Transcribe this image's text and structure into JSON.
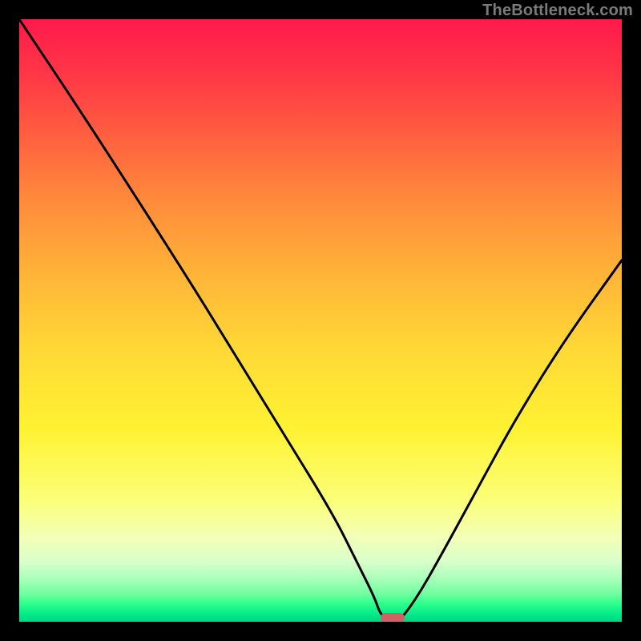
{
  "watermark": "TheBottleneck.com",
  "chart_data": {
    "type": "line",
    "title": "",
    "xlabel": "",
    "ylabel": "",
    "xlim": [
      0,
      100
    ],
    "ylim": [
      0,
      100
    ],
    "grid": false,
    "series": [
      {
        "name": "bottleneck-curve",
        "x": [
          0,
          12,
          28,
          36,
          44,
          52,
          56,
          59,
          60,
          62,
          63,
          66,
          70,
          76,
          82,
          90,
          100
        ],
        "values": [
          100,
          82,
          57,
          44,
          31,
          18,
          10,
          4,
          1,
          0,
          0,
          4,
          11,
          22,
          33,
          46,
          60
        ]
      }
    ],
    "marker": {
      "name": "optimal-point",
      "x": 62,
      "y": 0,
      "color": "#d06262"
    },
    "background_gradient": {
      "orientation": "vertical",
      "stops": [
        {
          "pos": 0.0,
          "color": "#ff1a4b"
        },
        {
          "pos": 0.3,
          "color": "#ff8a3b"
        },
        {
          "pos": 0.55,
          "color": "#ffd936"
        },
        {
          "pos": 0.8,
          "color": "#fbff7a"
        },
        {
          "pos": 0.93,
          "color": "#a6ffb8"
        },
        {
          "pos": 1.0,
          "color": "#00d285"
        }
      ]
    }
  }
}
